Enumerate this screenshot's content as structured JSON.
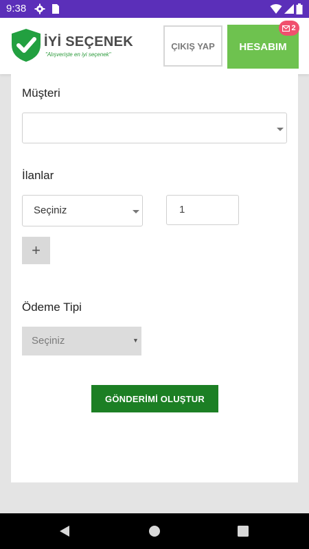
{
  "statusbar": {
    "time": "9:38"
  },
  "header": {
    "brand": "İYİ SEÇENEK",
    "slogan": "\"Alışverişte en iyi seçenek\"",
    "logout_label": "ÇIKIŞ YAP",
    "account_label": "HESABIM",
    "message_count": "2"
  },
  "form": {
    "customer_label": "Müşteri",
    "customer_value": "",
    "listings_label": "İlanlar",
    "listing_select": "Seçiniz",
    "quantity": "1",
    "add_label": "+",
    "payment_label": "Ödeme Tipi",
    "payment_select": "Seçiniz",
    "submit_label": "GÖNDERİMİ OLUŞTUR"
  },
  "colors": {
    "status_bar": "#5b2fb9",
    "accent_green": "#6ec24f",
    "submit_green": "#1c7f24",
    "badge": "#f0506e"
  }
}
